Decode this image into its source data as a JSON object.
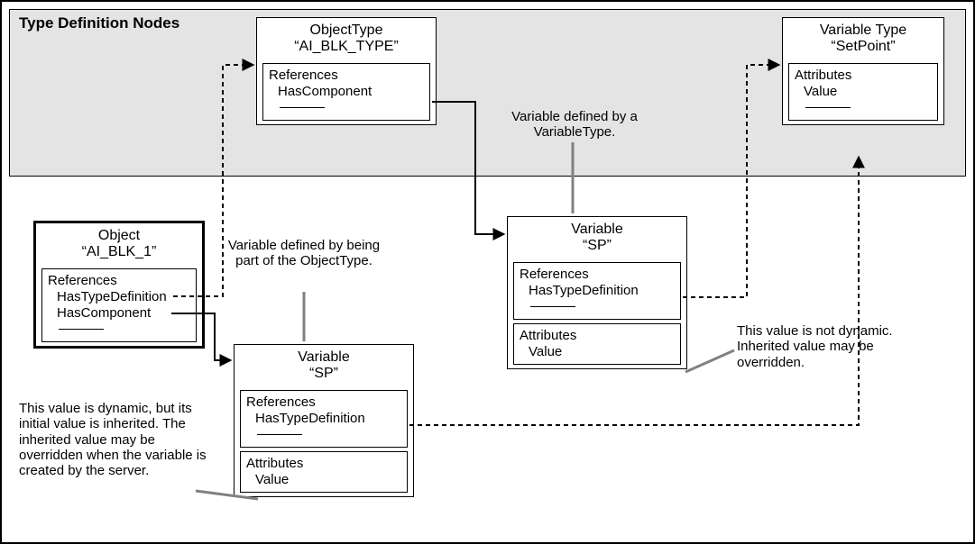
{
  "region": {
    "title": "Type Definition\nNodes"
  },
  "nodes": {
    "objectType": {
      "title": "ObjectType\n“AI_BLK_TYPE”",
      "box1_header": "References",
      "box1_line": "HasComponent"
    },
    "variableTypeSetPoint": {
      "title": "Variable Type\n“SetPoint”",
      "box1_header": "Attributes",
      "box1_line": "Value"
    },
    "objectBLK1": {
      "title": "Object\n“AI_BLK_1”",
      "box1_header": "References",
      "box1_line1": "HasTypeDefinition",
      "box1_line2": "HasComponent"
    },
    "variableSP_top": {
      "title": "Variable\n“SP”",
      "box1_header": "References",
      "box1_line": "HasTypeDefinition",
      "box2_header": "Attributes",
      "box2_line": "Value"
    },
    "variableSP_bottom": {
      "title": "Variable\n“SP”",
      "box1_header": "References",
      "box1_line": "HasTypeDefinition",
      "box2_header": "Attributes",
      "box2_line": "Value"
    }
  },
  "annotations": {
    "varDefByVarType": "Variable defined by a\nVariableType.",
    "varDefByObjType": "Variable defined by\nbeing part of the\nObjectType.",
    "dynamicValue": "This value is dynamic, but\nits initial value is inherited.\nThe inherited value may\nbe overridden when the\nvariable is created by the\nserver.",
    "notDynamic": "This value is not\ndynamic. Inherited value\nmay be overridden."
  }
}
